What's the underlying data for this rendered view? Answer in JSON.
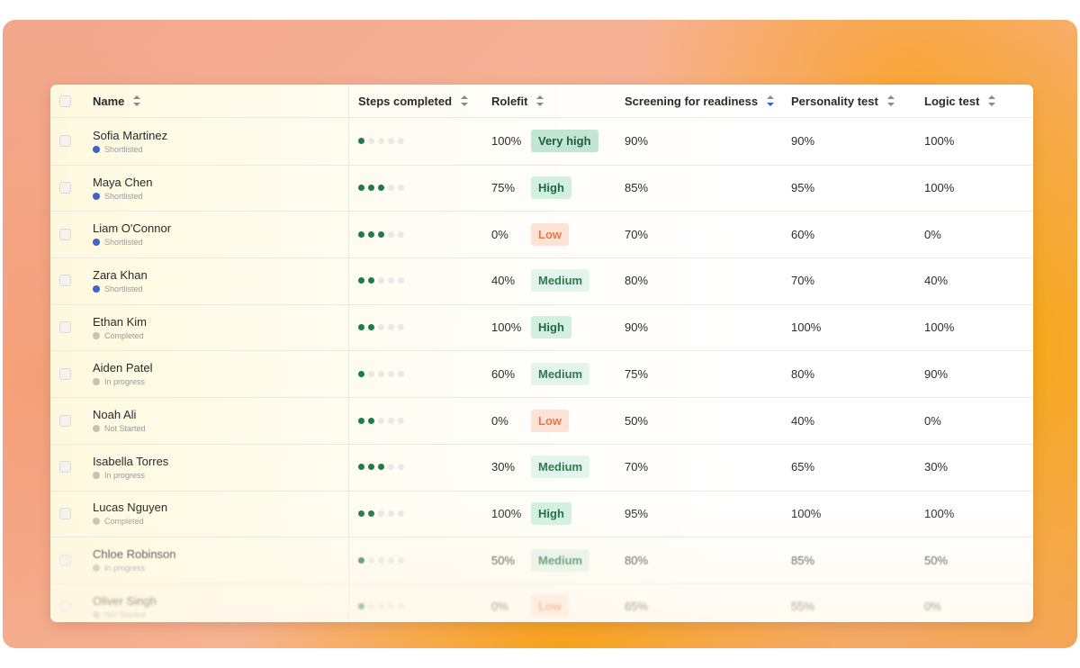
{
  "table": {
    "columns": [
      {
        "key": "name",
        "label": "Name",
        "sort_active": false
      },
      {
        "key": "steps",
        "label": "Steps completed",
        "sort_active": false
      },
      {
        "key": "rolefit",
        "label": "Rolefit",
        "sort_active": false
      },
      {
        "key": "screening",
        "label": "Screening for readiness",
        "sort_active": true
      },
      {
        "key": "personality",
        "label": "Personality test",
        "sort_active": false
      },
      {
        "key": "logic",
        "label": "Logic test",
        "sort_active": false
      }
    ],
    "status_colors": {
      "Shortlisted": "#3f63c9",
      "Completed": "#c9c2ae",
      "In progress": "#c9c2ae",
      "Not Started": "#c9c2ae"
    },
    "rows": [
      {
        "name": "Sofia Martinez",
        "status": "Shortlisted",
        "steps_done": 1,
        "steps_total": 5,
        "rolefit": "100%",
        "tier": "Very high",
        "tier_class": "tier-vh",
        "screening": "90%",
        "personality": "90%",
        "logic": "100%"
      },
      {
        "name": "Maya Chen",
        "status": "Shortlisted",
        "steps_done": 3,
        "steps_total": 5,
        "rolefit": "75%",
        "tier": "High",
        "tier_class": "tier-h",
        "screening": "85%",
        "personality": "95%",
        "logic": "100%"
      },
      {
        "name": "Liam O'Connor",
        "status": "Shortlisted",
        "steps_done": 3,
        "steps_total": 5,
        "rolefit": "0%",
        "tier": "Low",
        "tier_class": "tier-l",
        "screening": "70%",
        "personality": "60%",
        "logic": "0%"
      },
      {
        "name": "Zara Khan",
        "status": "Shortlisted",
        "steps_done": 2,
        "steps_total": 5,
        "rolefit": "40%",
        "tier": "Medium",
        "tier_class": "tier-m",
        "screening": "80%",
        "personality": "70%",
        "logic": "40%"
      },
      {
        "name": "Ethan Kim",
        "status": "Completed",
        "steps_done": 2,
        "steps_total": 5,
        "rolefit": "100%",
        "tier": "High",
        "tier_class": "tier-h",
        "screening": "90%",
        "personality": "100%",
        "logic": "100%"
      },
      {
        "name": "Aiden Patel",
        "status": "In progress",
        "steps_done": 1,
        "steps_total": 5,
        "rolefit": "60%",
        "tier": "Medium",
        "tier_class": "tier-m",
        "screening": "75%",
        "personality": "80%",
        "logic": "90%"
      },
      {
        "name": "Noah Ali",
        "status": "Not Started",
        "steps_done": 2,
        "steps_total": 5,
        "rolefit": "0%",
        "tier": "Low",
        "tier_class": "tier-l",
        "screening": "50%",
        "personality": "40%",
        "logic": "0%"
      },
      {
        "name": "Isabella Torres",
        "status": "In progress",
        "steps_done": 3,
        "steps_total": 5,
        "rolefit": "30%",
        "tier": "Medium",
        "tier_class": "tier-m",
        "screening": "70%",
        "personality": "65%",
        "logic": "30%"
      },
      {
        "name": "Lucas Nguyen",
        "status": "Completed",
        "steps_done": 2,
        "steps_total": 5,
        "rolefit": "100%",
        "tier": "High",
        "tier_class": "tier-h",
        "screening": "95%",
        "personality": "100%",
        "logic": "100%"
      },
      {
        "name": "Chloe Robinson",
        "status": "In progress",
        "steps_done": 1,
        "steps_total": 5,
        "rolefit": "50%",
        "tier": "Medium",
        "tier_class": "tier-m",
        "screening": "80%",
        "personality": "85%",
        "logic": "50%"
      },
      {
        "name": "Oliver Singh",
        "status": "Not Started",
        "steps_done": 1,
        "steps_total": 5,
        "rolefit": "0%",
        "tier": "Low",
        "tier_class": "tier-l",
        "screening": "65%",
        "personality": "55%",
        "logic": "0%"
      }
    ]
  }
}
